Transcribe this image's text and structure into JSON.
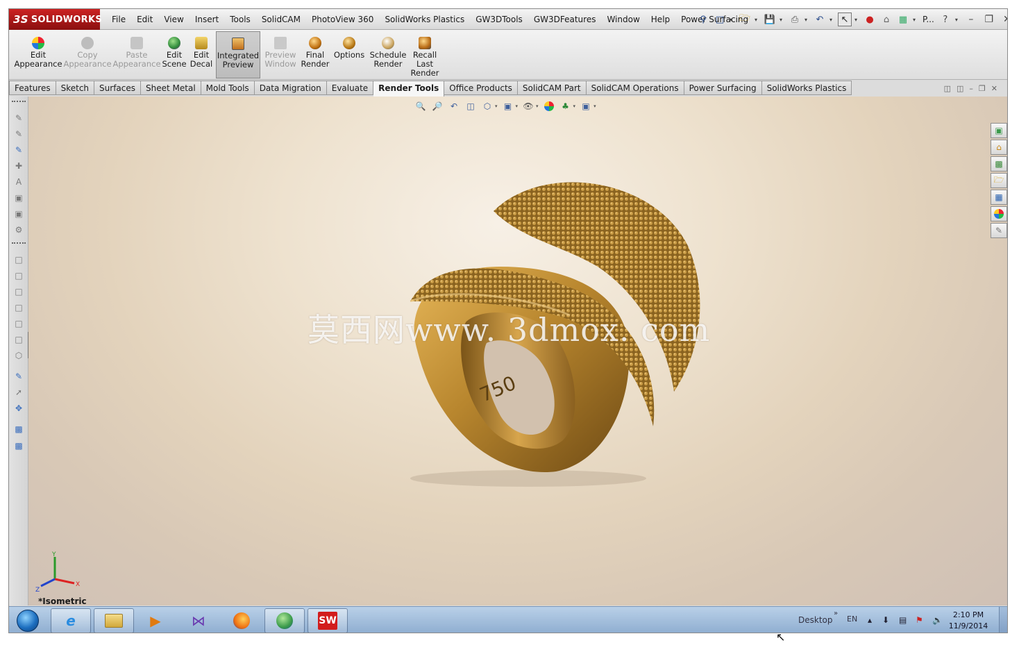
{
  "app": {
    "logo_prefix": "3S",
    "logo_text": "SOLIDWORKS"
  },
  "menu": [
    "File",
    "Edit",
    "View",
    "Insert",
    "Tools",
    "SolidCAM",
    "PhotoView 360",
    "SolidWorks Plastics",
    "GW3DTools",
    "GW3DFeatures",
    "Window",
    "Help",
    "Power Surfacing"
  ],
  "quick": {
    "truncated": "P..."
  },
  "commands": [
    {
      "line1": "Edit",
      "line2": "Appearance",
      "line3": "",
      "state": "normal"
    },
    {
      "line1": "Copy",
      "line2": "Appearance",
      "line3": "",
      "state": "disabled"
    },
    {
      "line1": "Paste",
      "line2": "Appearance",
      "line3": "",
      "state": "disabled"
    },
    {
      "line1": "Edit",
      "line2": "Scene",
      "line3": "",
      "state": "normal"
    },
    {
      "line1": "Edit",
      "line2": "Decal",
      "line3": "",
      "state": "normal"
    },
    {
      "line1": "Integrated",
      "line2": "Preview",
      "line3": "",
      "state": "active"
    },
    {
      "line1": "Preview",
      "line2": "Window",
      "line3": "",
      "state": "disabled"
    },
    {
      "line1": "Final",
      "line2": "Render",
      "line3": "",
      "state": "normal"
    },
    {
      "line1": "Options",
      "line2": "",
      "line3": "",
      "state": "normal"
    },
    {
      "line1": "Schedule",
      "line2": "Render",
      "line3": "",
      "state": "normal"
    },
    {
      "line1": "Recall",
      "line2": "Last",
      "line3": "Render",
      "state": "normal"
    }
  ],
  "tabs": [
    "Features",
    "Sketch",
    "Surfaces",
    "Sheet Metal",
    "Mold Tools",
    "Data Migration",
    "Evaluate",
    "Render Tools",
    "Office Products",
    "SolidCAM Part",
    "SolidCAM Operations",
    "Power Surfacing",
    "SolidWorks Plastics"
  ],
  "active_tab": "Render Tools",
  "viewport": {
    "watermark": "莫西网www. 3dmox. com",
    "ring_stamp": "750",
    "view_label": "*Isometric",
    "triad": {
      "x": "X",
      "y": "Y",
      "z": "Z"
    }
  },
  "taskbar": {
    "desktop_label": "Desktop",
    "chevron": "»",
    "lang": "EN",
    "time": "2:10 PM",
    "date": "11/9/2014"
  },
  "colors": {
    "logo_red": "#b3191b",
    "accent_blue": "#3d5f9c",
    "ring_gold": "#b8862e",
    "taskbar": "#9fbbdc"
  },
  "icons": [
    "start-orb-icon",
    "internet-explorer-icon",
    "file-explorer-icon",
    "media-player-icon",
    "visual-studio-icon",
    "firefox-icon",
    "globe-icon",
    "solidworks-icon"
  ]
}
